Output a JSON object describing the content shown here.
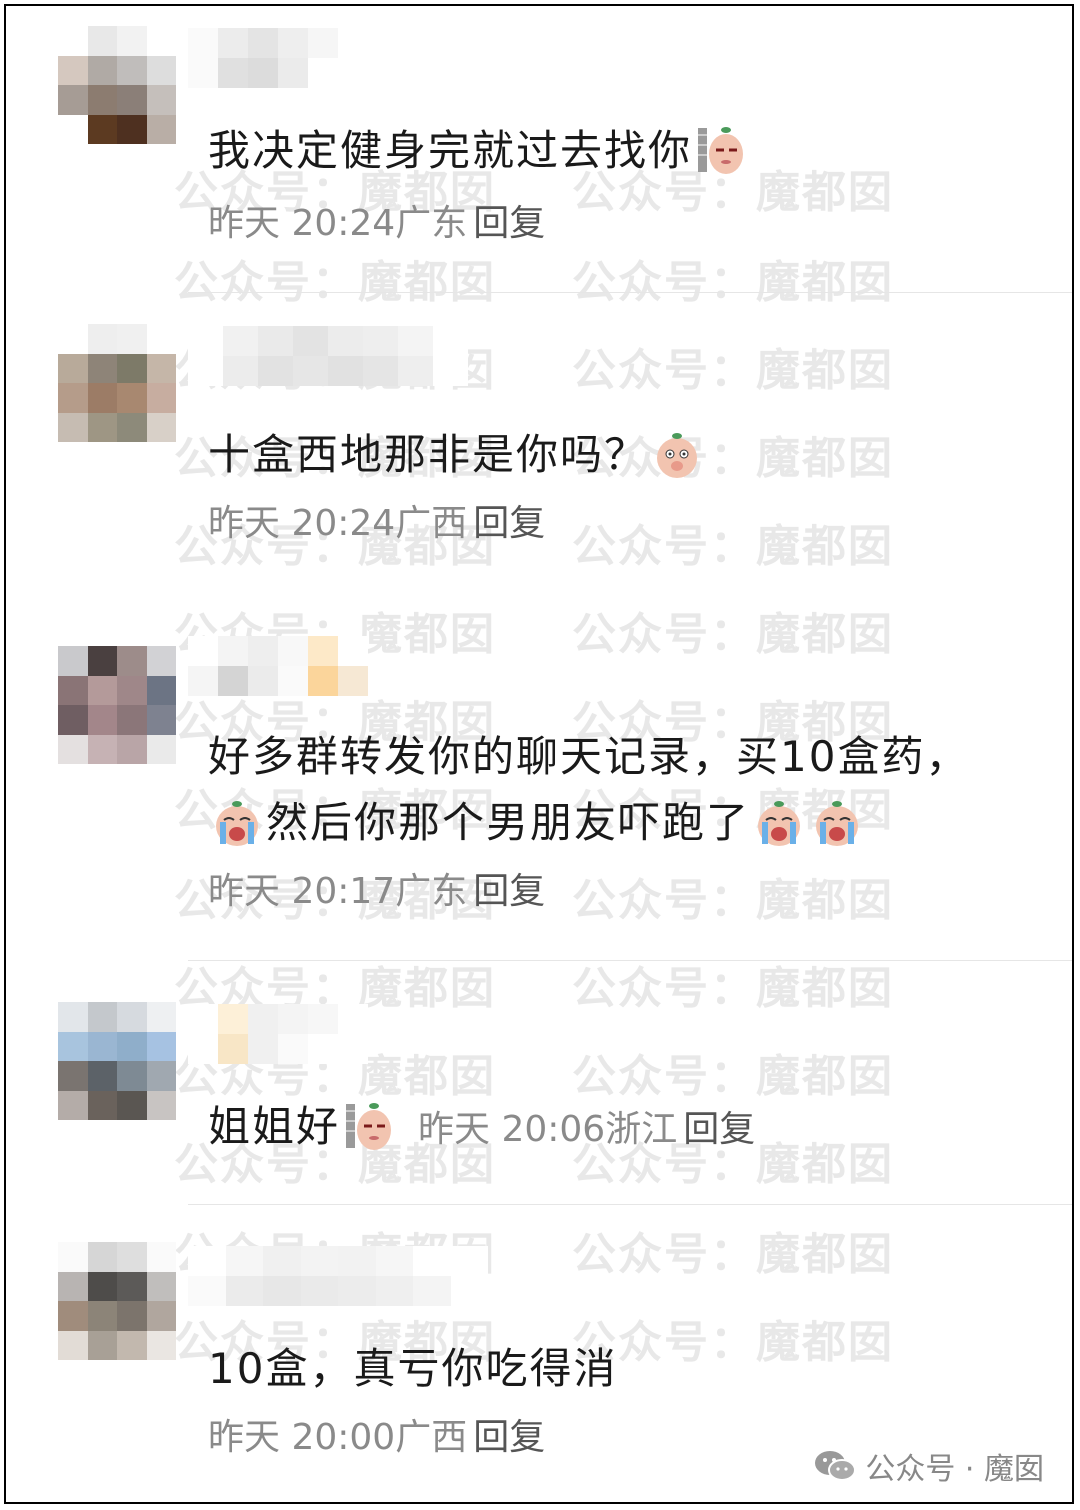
{
  "comments": [
    {
      "text": "我决定健身完就过去找你",
      "emoji_after": "smug-peanut-emoji",
      "time": "昨天 20:24",
      "location": "广东",
      "reply": "回复"
    },
    {
      "text": "十盒西地那非是你吗？",
      "emoji_after": "shy-peanut-emoji",
      "time": "昨天 20:24",
      "location": "广西",
      "reply": "回复"
    },
    {
      "text_line1": "好多群转发你的聊天记录，买10盒药，",
      "text_line2": "然后你那个男朋友吓跑了",
      "emoji_before": "crying-peanut-emoji",
      "emoji_after": "crying-peanut-emoji",
      "time": "昨天 20:17",
      "location": "广东",
      "reply": "回复"
    },
    {
      "text": "姐姐好",
      "emoji_after": "smug-peanut-emoji",
      "time": "昨天 20:06",
      "location": "浙江",
      "reply": "回复"
    },
    {
      "text": "10盒，真亏你吃得消",
      "time": "昨天 20:00",
      "location": "广西",
      "reply": "回复"
    }
  ],
  "watermark": {
    "text": "公众号：魔都囡"
  },
  "footer": {
    "label": "公众号 · 魔囡",
    "icon": "wechat-icon"
  },
  "colors": {
    "text": "#1a1a1a",
    "meta": "#8a8a8a",
    "watermark": "#bebebe"
  }
}
